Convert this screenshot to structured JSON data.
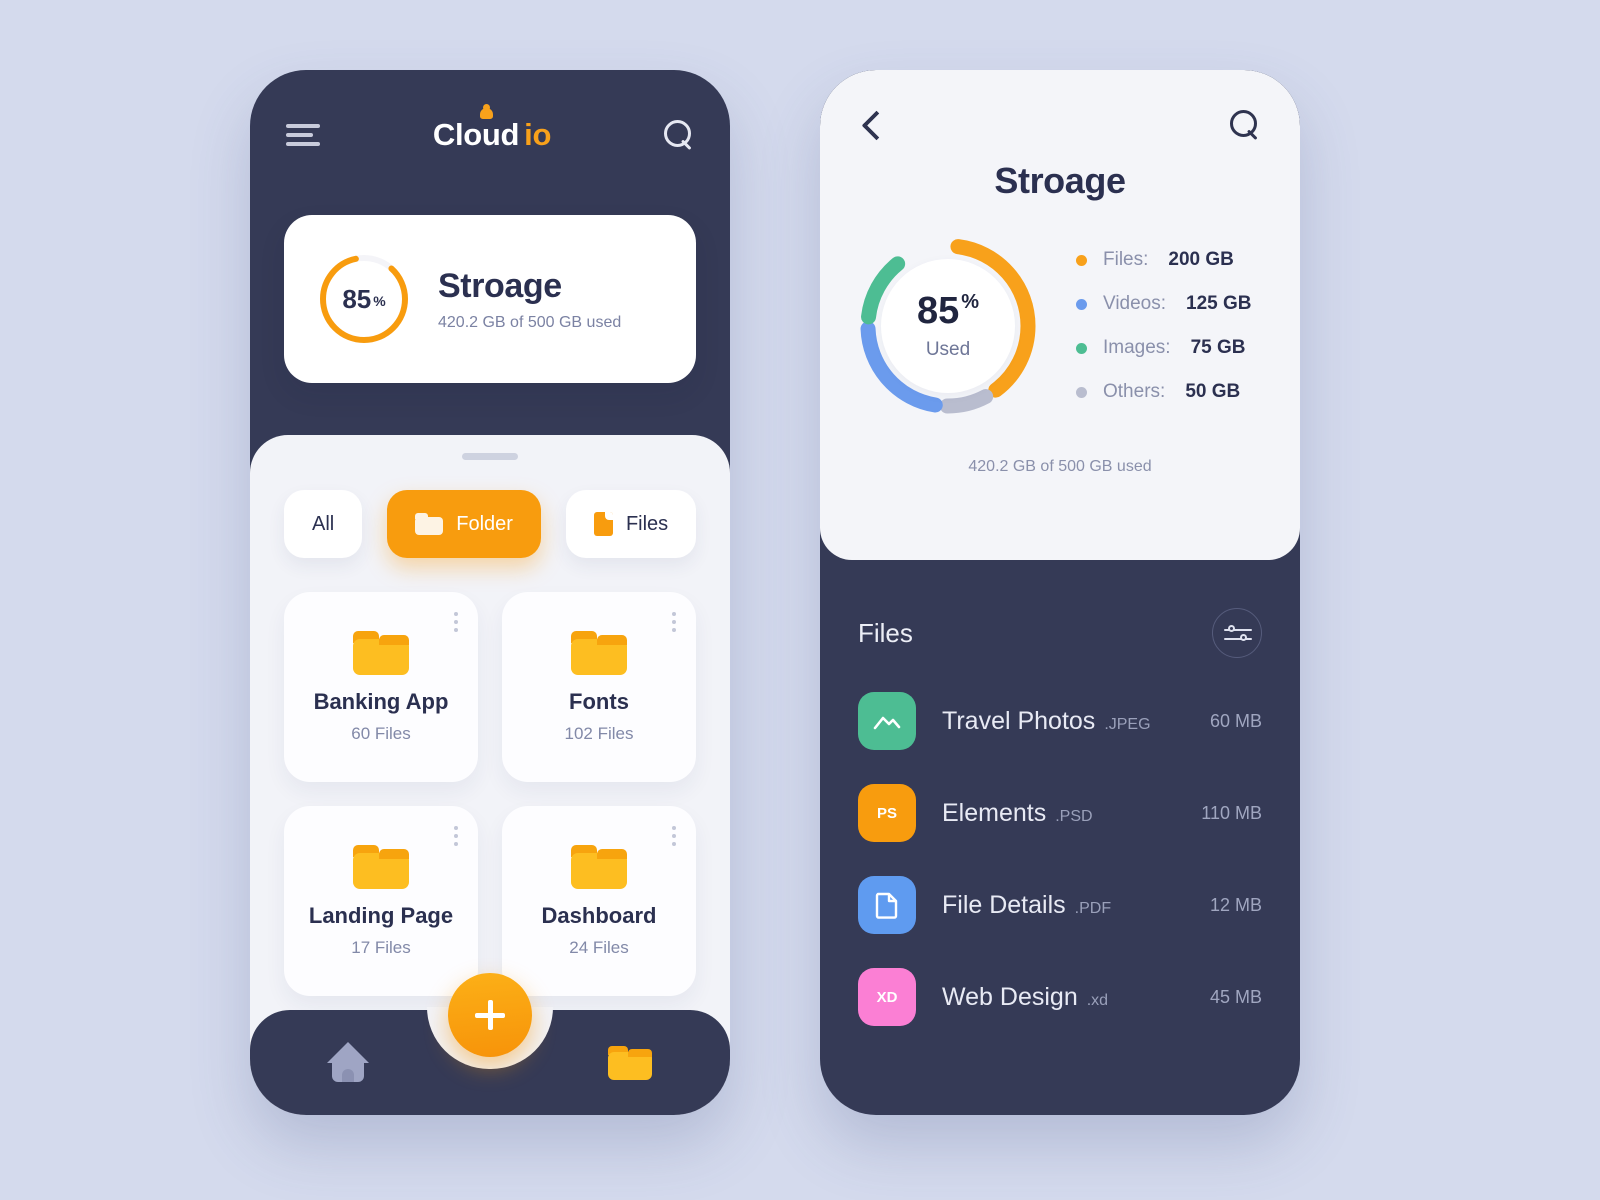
{
  "colors": {
    "background": "#d4daed",
    "dark_navy": "#353a56",
    "orange": "#f89c0e",
    "blue": "#6b9bed",
    "green": "#4dbd93",
    "grey": "#c3c7d8",
    "pink": "#fb7fd4"
  },
  "left_phone": {
    "header": {
      "menu_icon": "hamburger-icon",
      "logo_main": "Cloud",
      "logo_accent": "io",
      "search_icon": "search-icon"
    },
    "storage_card": {
      "percent": "85",
      "percent_symbol": "%",
      "title": "Stroage",
      "subtitle": "420.2 GB of 500 GB used"
    },
    "tabs": [
      {
        "label": "All",
        "icon": "none",
        "active": false
      },
      {
        "label": "Folder",
        "icon": "folder-icon",
        "active": true
      },
      {
        "label": "Files",
        "icon": "file-icon",
        "active": false
      }
    ],
    "folders": [
      {
        "name": "Banking App",
        "count": "60 Files"
      },
      {
        "name": "Fonts",
        "count": "102 Files"
      },
      {
        "name": "Landing Page",
        "count": "17 Files"
      },
      {
        "name": "Dashboard",
        "count": "24 Files"
      }
    ],
    "bottom_nav": {
      "home_icon": "home-icon",
      "fab_icon": "plus-icon",
      "folder_icon": "folder-icon"
    }
  },
  "right_phone": {
    "header": {
      "back_icon": "back-chevron-icon",
      "search_icon": "search-icon",
      "title": "Stroage"
    },
    "donut": {
      "percent": "85",
      "percent_symbol": "%",
      "used_label": "Used",
      "footer": "420.2 GB of 500 GB used"
    },
    "legend": [
      {
        "label": "Files:",
        "value": "200 GB",
        "color": "#f8a11b"
      },
      {
        "label": "Videos:",
        "value": "125 GB",
        "color": "#6b9bed"
      },
      {
        "label": "Images:",
        "value": "75 GB",
        "color": "#4dbd93"
      },
      {
        "label": "Others:",
        "value": "50 GB",
        "color": "#b9bdcf"
      }
    ],
    "files_section": {
      "title": "Files",
      "filter_icon": "filter-sliders-icon"
    },
    "files": [
      {
        "name": "Travel Photos",
        "ext": ".JPEG",
        "size": "60 MB",
        "badge": "",
        "color": "#4dbd93",
        "glyph": "image-icon"
      },
      {
        "name": "Elements",
        "ext": ".PSD",
        "size": "110 MB",
        "badge": "PS",
        "color": "#f89c0e",
        "glyph": "ps-badge"
      },
      {
        "name": "File Details",
        "ext": ".PDF",
        "size": "12 MB",
        "badge": "",
        "color": "#5f9bf0",
        "glyph": "document-icon"
      },
      {
        "name": "Web Design",
        "ext": ".xd",
        "size": "45 MB",
        "badge": "XD",
        "color": "#fb7fd4",
        "glyph": "xd-badge"
      }
    ]
  },
  "chart_data": [
    {
      "type": "pie",
      "title": "Stroage",
      "subtitle": "420.2 GB of 500 GB used",
      "categories": [
        "Used"
      ],
      "values": [
        85
      ],
      "unit": "%",
      "ylim": [
        0,
        100
      ],
      "legend_position": "none"
    },
    {
      "type": "pie",
      "title": "Stroage",
      "subtitle": "420.2 GB of 500 GB used",
      "categories": [
        "Files",
        "Videos",
        "Images",
        "Others"
      ],
      "values": [
        200,
        125,
        75,
        50
      ],
      "unit": "GB",
      "total": 500,
      "used_percent": 85,
      "colors": [
        "#f8a11b",
        "#6b9bed",
        "#4dbd93",
        "#b9bdcf"
      ],
      "legend_position": "right"
    }
  ]
}
